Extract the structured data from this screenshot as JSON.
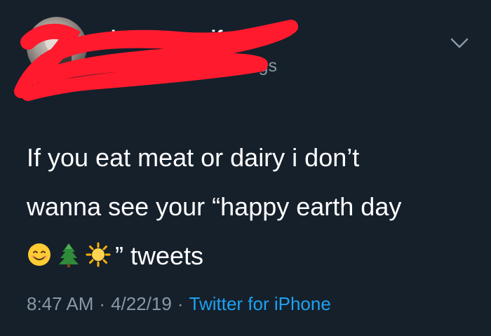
{
  "tweet": {
    "display_name": "hummus wife",
    "handle": "@",
    "handle_visible_tail": "igs",
    "text_line1": "If you eat meat or dairy i don’t",
    "text_line2": "wanna see your “happy earth day",
    "text_line3_suffix": "” tweets",
    "emojis": [
      "smiling-face-emoji",
      "evergreen-tree-emoji",
      "sun-emoji"
    ],
    "time": "8:47 AM",
    "date": "4/22/19",
    "separator": "·",
    "source": "Twitter for iPhone"
  },
  "colors": {
    "background": "#15202b",
    "text": "#ffffff",
    "secondary": "#8899a6",
    "link": "#1da1f2",
    "redaction": "#ff1a2e"
  }
}
